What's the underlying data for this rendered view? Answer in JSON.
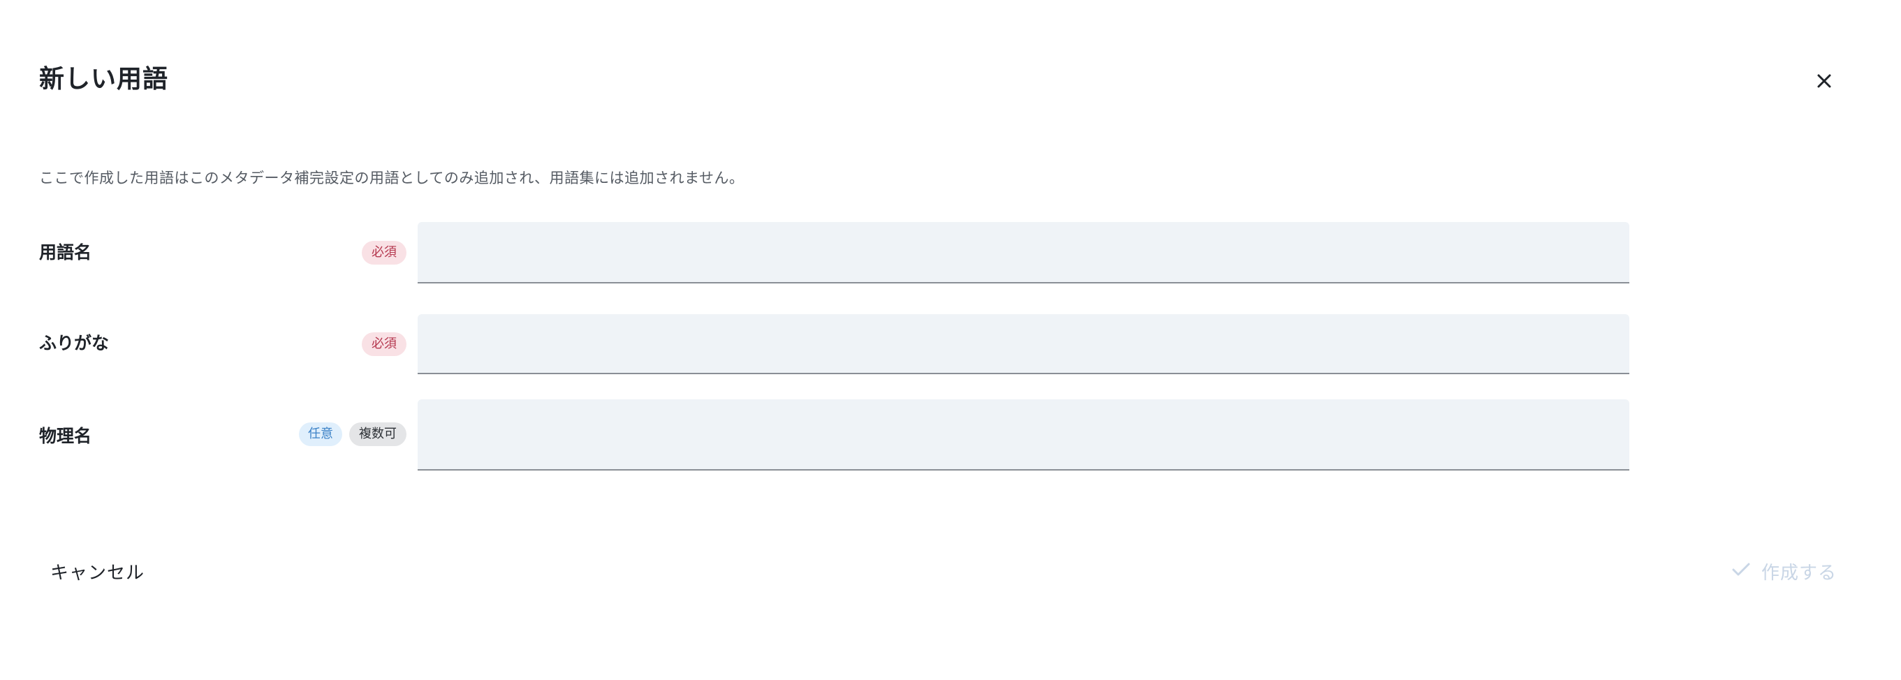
{
  "dialog": {
    "title": "新しい用語",
    "close_icon": "close-icon",
    "description": "ここで作成した用語はこのメタデータ補完設定の用語としてのみ追加され、用語集には追加されません。"
  },
  "fields": [
    {
      "label": "用語名",
      "badges": [
        "必須"
      ],
      "value": ""
    },
    {
      "label": "ふりがな",
      "badges": [
        "必須"
      ],
      "value": ""
    },
    {
      "label": "物理名",
      "badges": [
        "任意",
        "複数可"
      ],
      "value": ""
    }
  ],
  "actions": {
    "cancel_label": "キャンセル",
    "create_label": "作成する",
    "create_icon": "check-icon",
    "create_enabled": false
  },
  "colors": {
    "required_badge_bg": "#f9e1e5",
    "required_badge_text": "#b5384f",
    "optional_badge_bg": "#e0effc",
    "optional_badge_text": "#3c82c7",
    "multiple_badge_bg": "#e4e5e7",
    "input_bg": "#eff3f7",
    "disabled_action": "#c9d6e6"
  }
}
